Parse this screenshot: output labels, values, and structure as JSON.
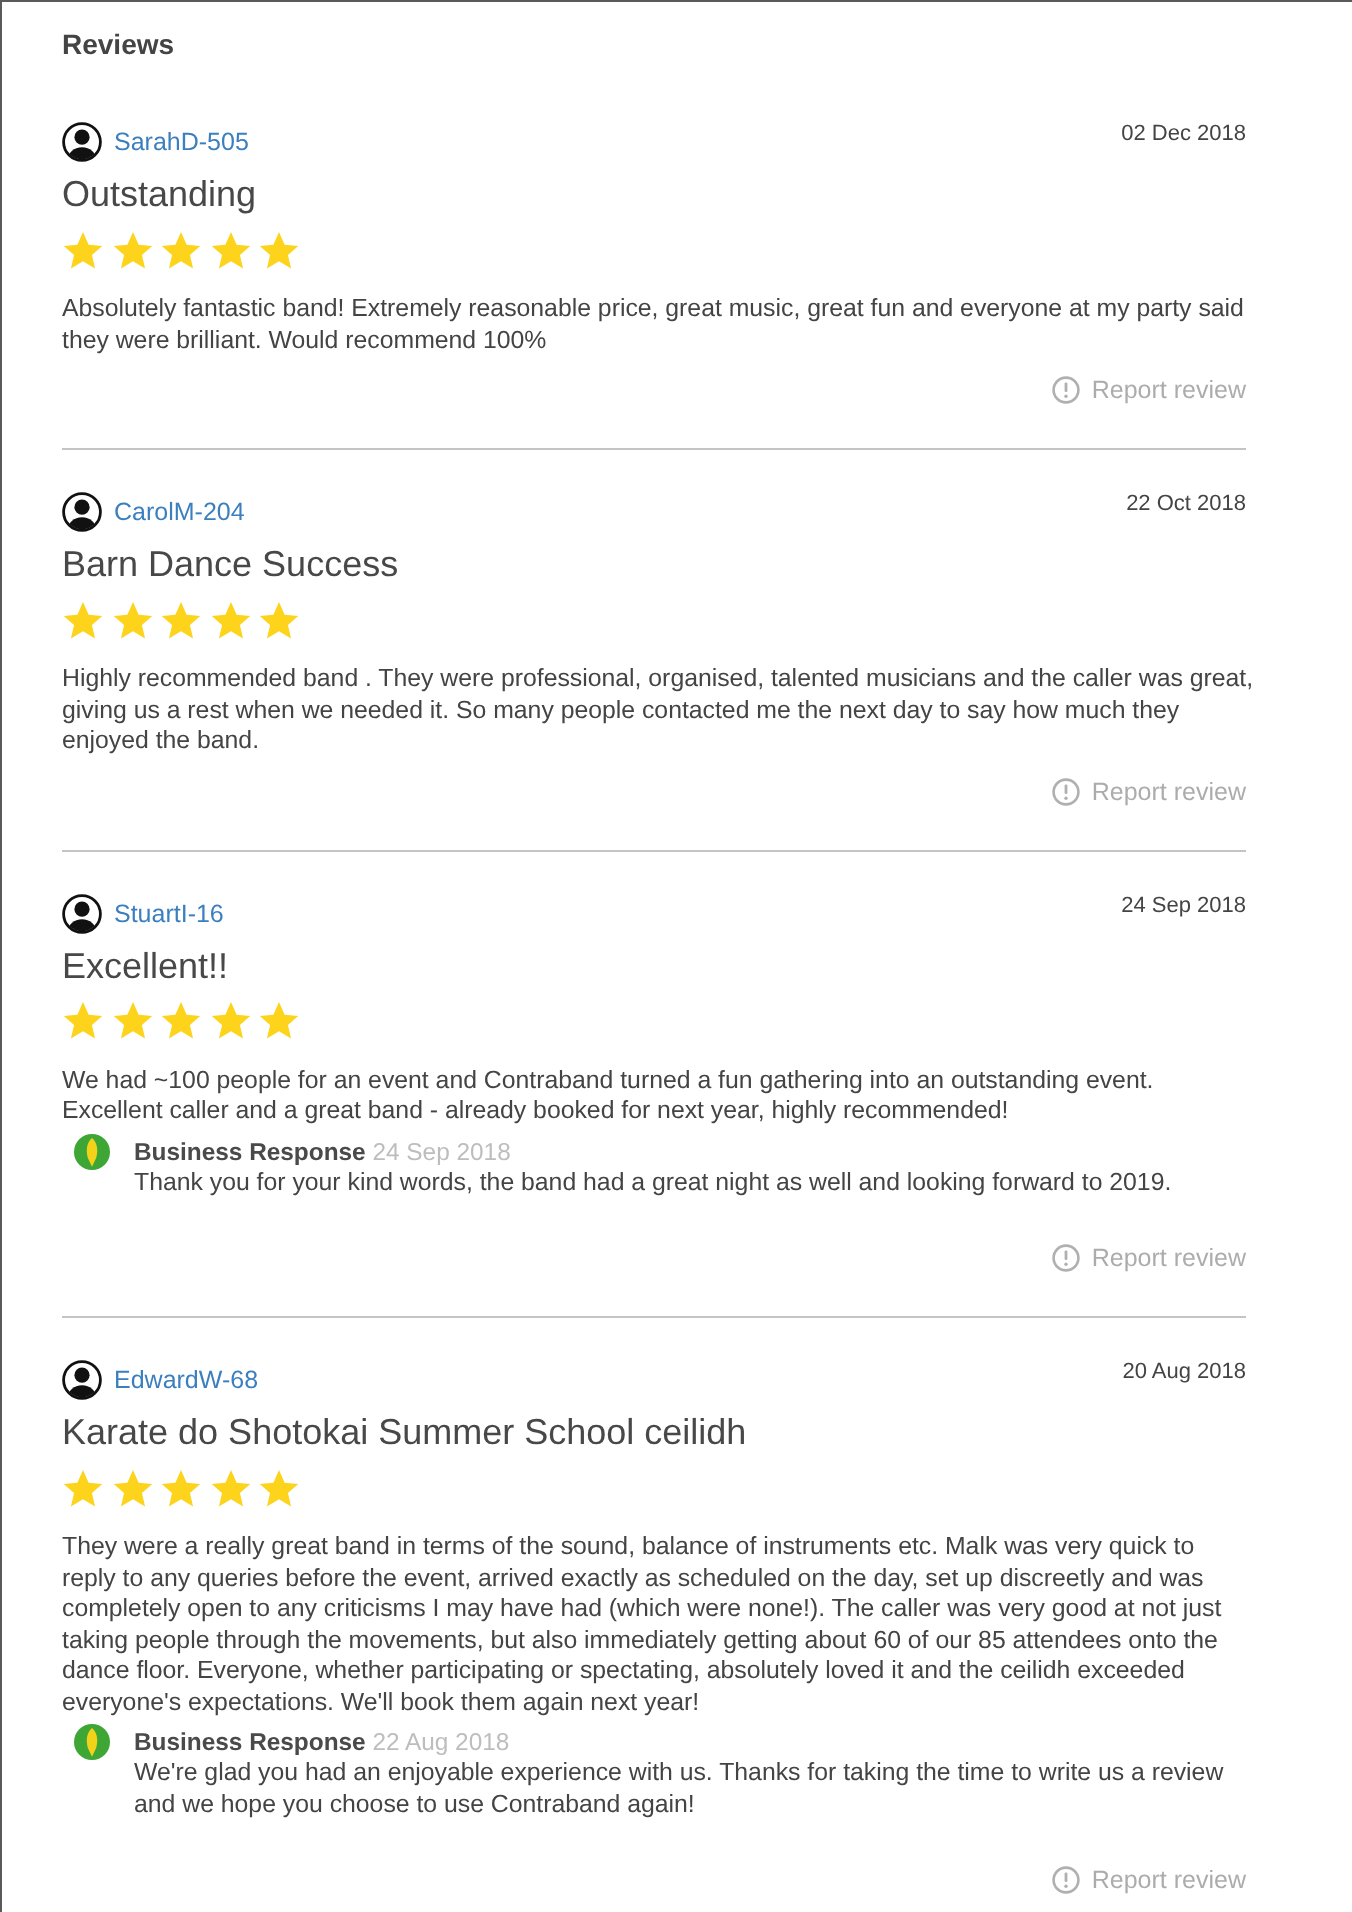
{
  "title": "Reviews",
  "reviews": [
    {
      "author": "SarahD-505",
      "date": "02 Dec 2018",
      "title": "Outstanding",
      "stars": 5,
      "body": "Absolutely fantastic band! Extremely reasonable price, great music, great fun and everyone at my party said they were brilliant. Would recommend 100%",
      "report": "Report review"
    },
    {
      "author": "CarolM-204",
      "date": "22 Oct 2018",
      "title": "Barn Dance Success",
      "stars": 5,
      "body": "Highly recommended band . They were professional, organised, talented musicians and the caller was great, giving us a rest when we needed it. So many people contacted me the next day to say how much they enjoyed the band.",
      "report": "Report review"
    },
    {
      "author": "StuartI-16",
      "date": "24 Sep 2018",
      "title": "Excellent!!",
      "stars": 5,
      "body": "We had ~100 people for an event and Contraband turned a fun gathering into an outstanding event. Excellent caller and a great band - already booked for next year, highly recommended!",
      "response": {
        "label": "Business Response",
        "date": "24 Sep 2018",
        "text": "Thank you for your kind words, the band had a great night as well and looking forward to 2019."
      },
      "report": "Report review"
    },
    {
      "author": "EdwardW-68",
      "date": "20 Aug 2018",
      "title": "Karate do Shotokai Summer School ceilidh",
      "stars": 5,
      "body": "They were a really great band in terms of the sound, balance of instruments etc. Malk was very quick to reply to any queries before the event, arrived exactly as scheduled on the day, set up discreetly and was completely open to any criticisms I may have had (which were none!). The caller was very good at not just taking people through the movements, but also immediately getting about 60 of our 85 attendees onto the dance floor. Everyone, whether participating or spectating, absolutely loved it and the ceilidh exceeded everyone's expectations. We'll book them again next year!",
      "response": {
        "label": "Business Response",
        "date": "22 Aug 2018",
        "text": "We're glad you had an enjoyable experience with us. Thanks for taking the time to write us a review and we hope you choose to use Contraband again!"
      },
      "report": "Report review"
    }
  ]
}
